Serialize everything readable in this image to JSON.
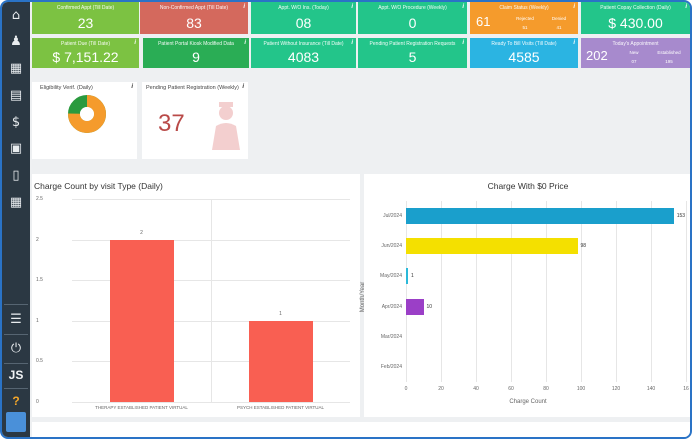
{
  "sidebar": {
    "icons": [
      "home-icon",
      "user-icon",
      "calendar-icon",
      "document-icon",
      "dollar-icon",
      "cards-icon",
      "file-icon",
      "grid-icon",
      "menu-icon",
      "power-icon"
    ],
    "user_initials": "JS",
    "help": "?"
  },
  "tiles_row1": [
    {
      "title": "Confirmed Appt (Till Date)",
      "value": "23",
      "color": "green"
    },
    {
      "title": "Non-Confirmed Appt (Till Date)",
      "value": "83",
      "color": "red"
    },
    {
      "title": "Appt. W/O Ins. (Today)",
      "value": "08",
      "color": "teal"
    },
    {
      "title": "Appt. W/O Procedure (Weekly)",
      "value": "0",
      "color": "teal"
    },
    {
      "title": "Claim Status (Weekly)",
      "value": "61",
      "rejected_label": "Rejected",
      "rejected": "51",
      "denied_label": "Denied",
      "denied": "41",
      "color": "orange"
    },
    {
      "title": "Patient Copay Collection (Daily)",
      "value": "$ 430.00",
      "color": "teal"
    }
  ],
  "tiles_row2": [
    {
      "title": "Patient Due (Till Date)",
      "value": "$ 7,151.22",
      "color": "green"
    },
    {
      "title": "Patient Portal Kiosk Modified Data",
      "value": "9",
      "color": "dgreen"
    },
    {
      "title": "Patient Without Insurance (Till Date)",
      "value": "4083",
      "color": "teal"
    },
    {
      "title": "Pending Patient Registration Requests",
      "value": "5",
      "color": "teal"
    },
    {
      "title": "Ready To Bill Visits (Till Date)",
      "value": "4585",
      "color": "blue"
    },
    {
      "title": "Today's Appointment",
      "value": "202",
      "new_label": "New",
      "new": "07",
      "est_label": "Established",
      "est": "195",
      "color": "purple"
    }
  ],
  "cards": {
    "eligibility": {
      "title": "Eligibility Verif. (Daily)",
      "segments": [
        {
          "color": "#f59b2c",
          "value": 75
        },
        {
          "color": "#2a9a3e",
          "value": 25
        }
      ]
    },
    "pending_reg": {
      "title": "Pending Patient Registration (Weekly)",
      "value": "37"
    }
  },
  "chart_data": [
    {
      "type": "bar",
      "title": "Charge Count by visit Type (Daily)",
      "categories": [
        "THERAPY ESTABLISHED PATIENT VIRTUAL",
        "PSYCH ESTABLISHED PATIENT VIRTUAL"
      ],
      "values": [
        2,
        1
      ],
      "ylim": [
        0,
        2.5
      ],
      "yticks": [
        "2.5",
        "2",
        "1.5",
        "1",
        "0.5",
        "0"
      ],
      "color": "#f95f52"
    },
    {
      "type": "bar",
      "orientation": "horizontal",
      "title": "Charge With $0 Price",
      "categories": [
        "Jul/2024",
        "Jun/2024",
        "May/2024",
        "Apr/2024",
        "Mar/2024",
        "Feb/2024"
      ],
      "values": [
        153,
        98,
        1,
        10,
        0,
        0
      ],
      "colors": [
        "#1a9fcc",
        "#f4e000",
        "#2bb9d9",
        "#9b3fc7",
        "#cccccc",
        "#cccccc"
      ],
      "xlabel": "Charge Count",
      "ylabel": "Month/Year",
      "xlim": [
        0,
        160
      ],
      "xticks": [
        "0",
        "20",
        "40",
        "60",
        "80",
        "100",
        "120",
        "140",
        "16"
      ]
    }
  ]
}
